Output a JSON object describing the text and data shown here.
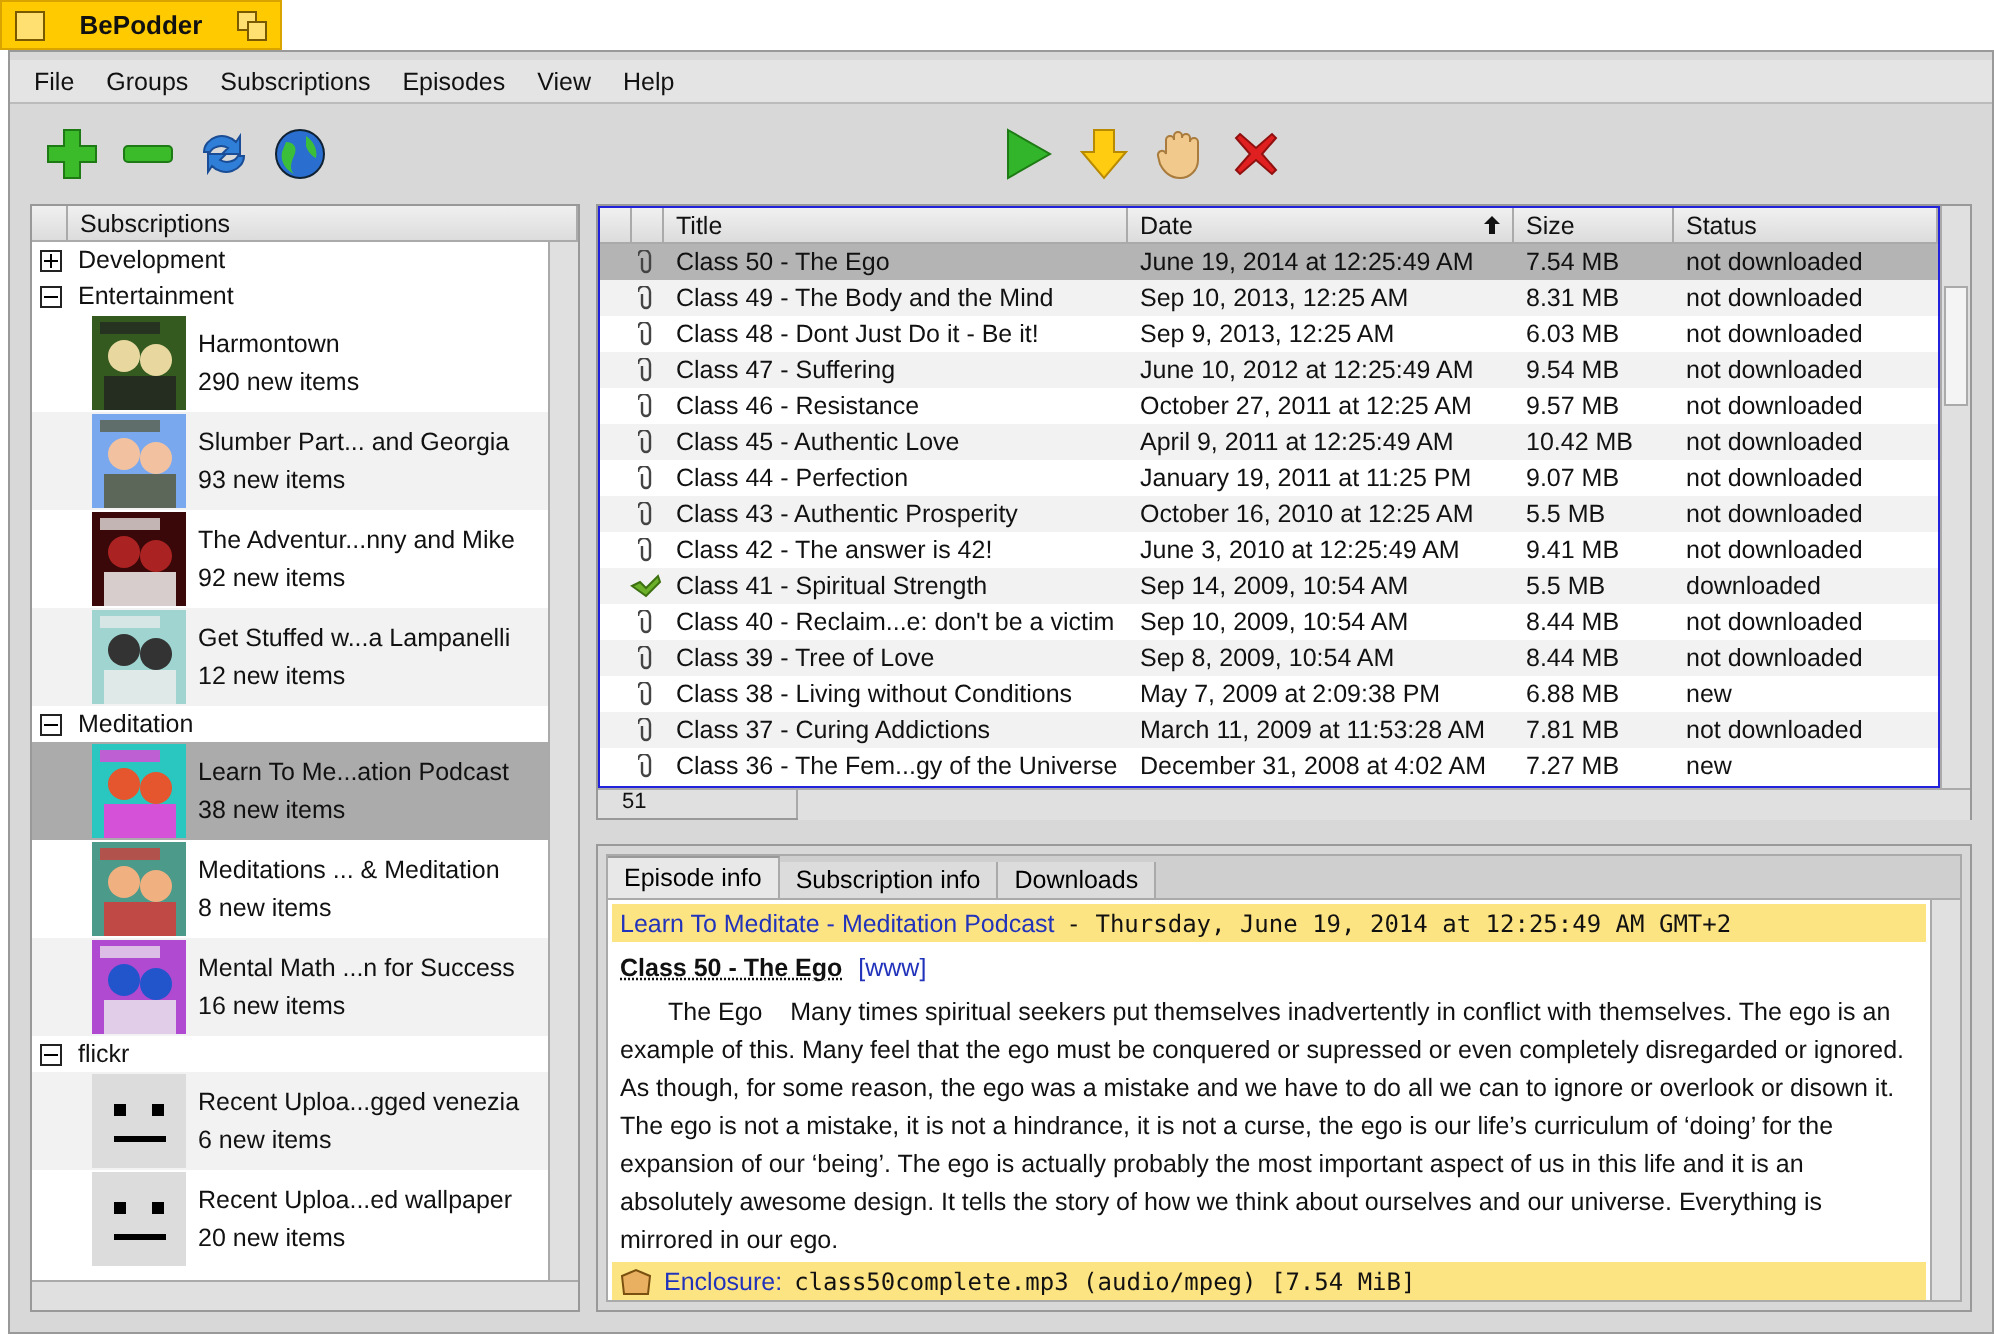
{
  "window": {
    "title": "BePodder"
  },
  "menu": [
    "File",
    "Groups",
    "Subscriptions",
    "Episodes",
    "View",
    "Help"
  ],
  "subscriptions": {
    "header": "Subscriptions",
    "groups": [
      {
        "name": "Development",
        "expanded": false
      },
      {
        "name": "Entertainment",
        "expanded": true,
        "children": [
          {
            "title": "Harmontown",
            "count": "290 new items",
            "selected": false,
            "kind": "picture"
          },
          {
            "title": "Slumber Part... and Georgia",
            "count": "93 new items",
            "selected": false,
            "kind": "picture"
          },
          {
            "title": "The Adventur...nny and Mike",
            "count": "92 new items",
            "selected": false,
            "kind": "picture"
          },
          {
            "title": "Get Stuffed w...a Lampanelli",
            "count": "12 new items",
            "selected": false,
            "kind": "picture"
          }
        ]
      },
      {
        "name": "Meditation",
        "expanded": true,
        "children": [
          {
            "title": "Learn To Me...ation Podcast",
            "count": "38 new items",
            "selected": true,
            "kind": "picture"
          },
          {
            "title": "Meditations ... & Meditation",
            "count": "8 new items",
            "selected": false,
            "kind": "picture"
          },
          {
            "title": "Mental Math ...n for Success",
            "count": "16 new items",
            "selected": false,
            "kind": "picture"
          }
        ]
      },
      {
        "name": "flickr",
        "expanded": true,
        "children": [
          {
            "title": "Recent Uploa...gged venezia",
            "count": "6 new items",
            "selected": false,
            "kind": "placeholder"
          },
          {
            "title": "Recent Uploa...ed wallpaper",
            "count": "20 new items",
            "selected": false,
            "kind": "placeholder"
          }
        ]
      }
    ]
  },
  "episodes": {
    "columns": [
      "Title",
      "Date",
      "Size",
      "Status"
    ],
    "count": "51",
    "rows": [
      {
        "kind": "attachment",
        "title": "Class 50 - The Ego",
        "date": "June 19, 2014 at 12:25:49 AM",
        "size": "7.54 MB",
        "status": "not downloaded",
        "selected": true
      },
      {
        "kind": "attachment",
        "title": "Class 49 - The Body and the Mind",
        "date": "Sep 10, 2013, 12:25 AM",
        "size": "8.31 MB",
        "status": "not downloaded",
        "selected": false
      },
      {
        "kind": "attachment",
        "title": "Class 48 - Dont Just Do it - Be it!",
        "date": "Sep 9, 2013, 12:25 AM",
        "size": "6.03 MB",
        "status": "not downloaded",
        "selected": false
      },
      {
        "kind": "attachment",
        "title": "Class 47 - Suffering",
        "date": "June 10, 2012 at 12:25:49 AM",
        "size": "9.54 MB",
        "status": "not downloaded",
        "selected": false
      },
      {
        "kind": "attachment",
        "title": "Class 46 - Resistance",
        "date": "October 27, 2011 at 12:25 AM",
        "size": "9.57 MB",
        "status": "not downloaded",
        "selected": false
      },
      {
        "kind": "attachment",
        "title": "Class 45 - Authentic Love",
        "date": "April 9, 2011 at 12:25:49 AM",
        "size": "10.42 MB",
        "status": "not downloaded",
        "selected": false
      },
      {
        "kind": "attachment",
        "title": "Class 44 - Perfection",
        "date": "January 19, 2011 at 11:25 PM",
        "size": "9.07 MB",
        "status": "not downloaded",
        "selected": false
      },
      {
        "kind": "attachment",
        "title": "Class 43 - Authentic Prosperity",
        "date": "October 16, 2010 at 12:25 AM",
        "size": "5.5 MB",
        "status": "not downloaded",
        "selected": false
      },
      {
        "kind": "attachment",
        "title": "Class 42 - The answer is 42!",
        "date": "June 3, 2010 at 12:25:49 AM",
        "size": "9.41 MB",
        "status": "not downloaded",
        "selected": false
      },
      {
        "kind": "downloaded",
        "title": "Class 41 - Spiritual Strength",
        "date": "Sep 14, 2009, 10:54 AM",
        "size": "5.5 MB",
        "status": "downloaded",
        "selected": false
      },
      {
        "kind": "attachment",
        "title": "Class 40 - Reclaim...e: don't be a victim",
        "date": "Sep 10, 2009, 10:54 AM",
        "size": "8.44 MB",
        "status": "not downloaded",
        "selected": false
      },
      {
        "kind": "attachment",
        "title": "Class 39 - Tree of Love",
        "date": "Sep 8, 2009, 10:54 AM",
        "size": "8.44 MB",
        "status": "not downloaded",
        "selected": false
      },
      {
        "kind": "attachment",
        "title": "Class 38 - Living without Conditions",
        "date": "May 7, 2009 at 2:09:38 PM",
        "size": "6.88 MB",
        "status": "new",
        "selected": false
      },
      {
        "kind": "attachment",
        "title": "Class 37 - Curing Addictions",
        "date": "March 11, 2009 at 11:53:28 AM",
        "size": "7.81 MB",
        "status": "not downloaded",
        "selected": false
      },
      {
        "kind": "attachment",
        "title": "Class 36 - The Fem...gy of the Universe",
        "date": "December 31, 2008 at 4:02 AM",
        "size": "7.27 MB",
        "status": "new",
        "selected": false
      }
    ]
  },
  "details": {
    "tabs": [
      {
        "label": "Episode info",
        "selected": true
      },
      {
        "label": "Subscription info",
        "selected": false
      },
      {
        "label": "Downloads",
        "selected": false
      }
    ],
    "podcast": "Learn To Meditate - Meditation Podcast",
    "published": "- Thursday, June 19, 2014 at 12:25:49 AM GMT+2",
    "episode_title": "Class 50 - The Ego",
    "link": "[www]",
    "description": "The Ego    Many times spiritual seekers put themselves inadvertently in conflict with themselves. The ego is an example of this. Many feel that the ego must be conquered or supressed or even completely disregarded or ignored. As though, for some reason, the ego was a mistake and we have to do all we can to ignore or overlook or disown it. The ego is not a mistake, it is not a hindrance, it is not a curse, the ego is our life’s curriculum of ‘doing’ for the expansion of our ‘being’. The ego is actually probably the most important aspect of us in this life and it is an absolutely awesome design. It tells the story of how we think about ourselves and our universe. Everything is mirrored in our ego.",
    "enclosure_label": "Enclosure:",
    "enclosure": "class50complete.mp3 (audio/mpeg)   [7.54 MiB]"
  }
}
